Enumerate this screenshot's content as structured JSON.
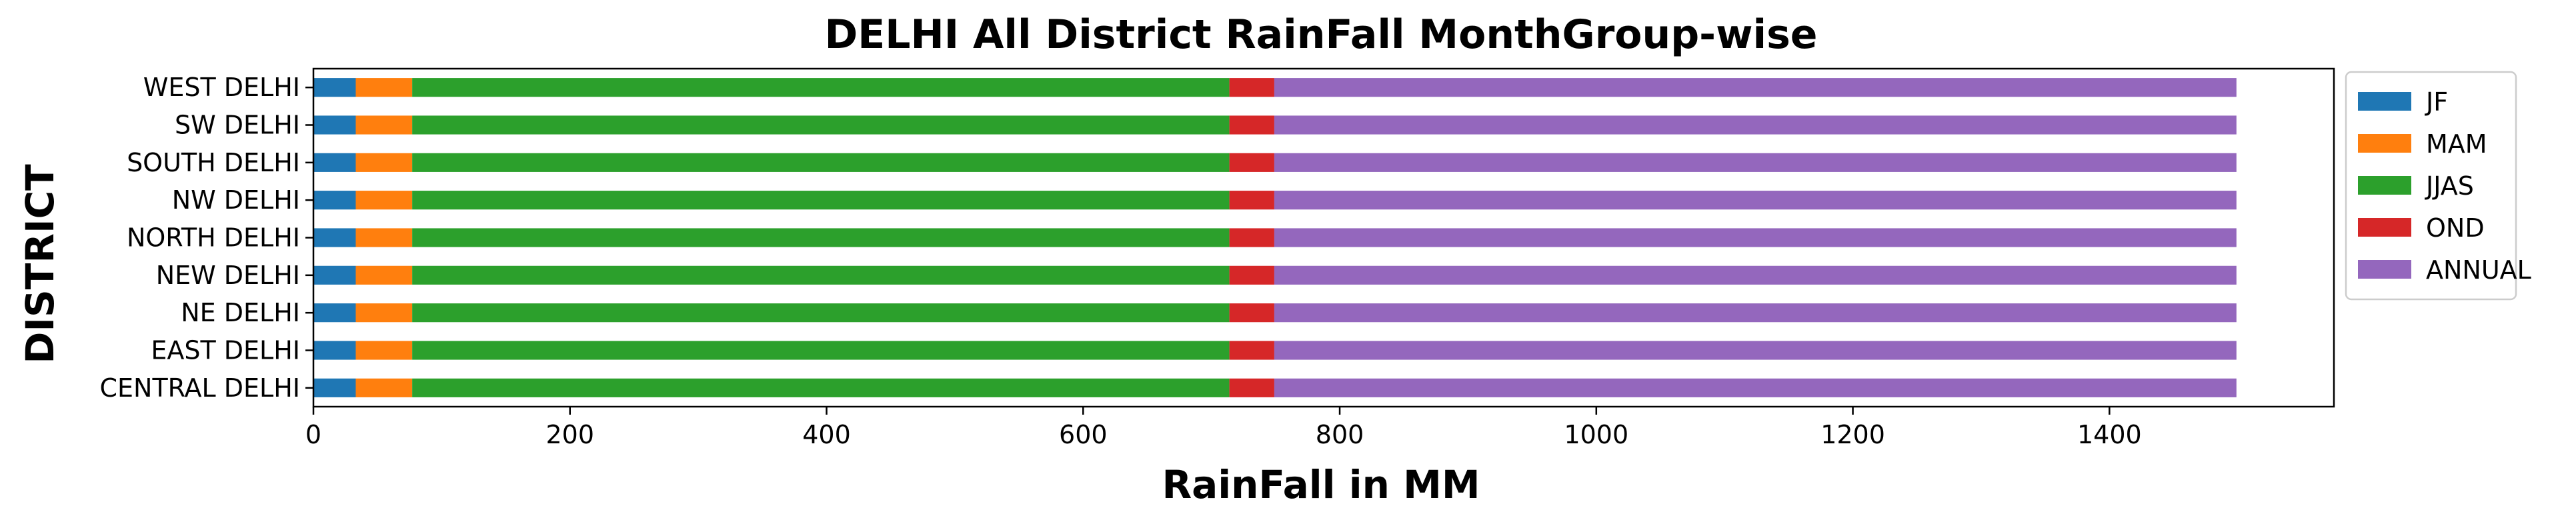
{
  "chart_data": {
    "type": "bar",
    "orientation": "horizontal",
    "stacked": true,
    "title": "DELHI All District RainFall MonthGroup-wise",
    "xlabel": "RainFall in MM",
    "ylabel": "DISTRICT",
    "xlim": [
      0,
      1575
    ],
    "xticks": [
      "0",
      "200",
      "400",
      "600",
      "800",
      "1000",
      "1200",
      "1400"
    ],
    "grid": false,
    "legend_position": "upper-right-outside",
    "categories": [
      "CENTRAL DELHI",
      "EAST DELHI",
      "NE DELHI",
      "NEW DELHI",
      "NORTH DELHI",
      "NW DELHI",
      "SOUTH DELHI",
      "SW DELHI",
      "WEST DELHI"
    ],
    "series": [
      {
        "name": "JF",
        "color": "#1f77b4",
        "values": [
          33,
          33,
          33,
          33,
          33,
          33,
          33,
          33,
          33
        ]
      },
      {
        "name": "MAM",
        "color": "#ff7f0e",
        "values": [
          44,
          44,
          44,
          44,
          44,
          44,
          44,
          44,
          44
        ]
      },
      {
        "name": "JJAS",
        "color": "#2ca02c",
        "values": [
          637,
          637,
          637,
          637,
          637,
          637,
          637,
          637,
          637
        ]
      },
      {
        "name": "OND",
        "color": "#d62728",
        "values": [
          35,
          35,
          35,
          35,
          35,
          35,
          35,
          35,
          35
        ]
      },
      {
        "name": "ANNUAL",
        "color": "#9467bd",
        "values": [
          750,
          750,
          750,
          750,
          750,
          750,
          750,
          750,
          750
        ]
      }
    ]
  }
}
